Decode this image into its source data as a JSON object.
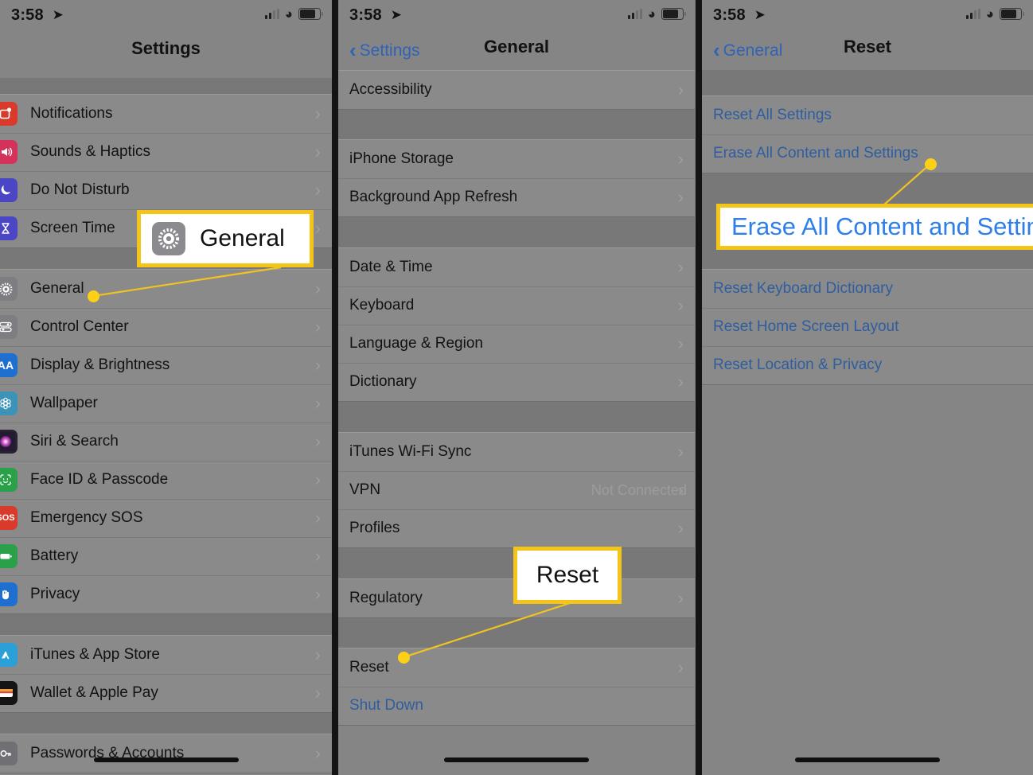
{
  "status_bar": {
    "time": "3:58",
    "location_arrow_icon": "location-arrow-icon",
    "cellular_icon": "cellular-signal-icon",
    "wifi_icon": "wifi-icon",
    "battery_icon": "battery-icon"
  },
  "colors": {
    "highlight_border": "#f4c517",
    "dot": "#fdd017",
    "link_blue": "#2f5d9e",
    "callout_blue": "#2f7fea",
    "overlay_gray": "#858585"
  },
  "panel_settings": {
    "title": "Settings",
    "groups": [
      {
        "rows": [
          {
            "label": "Notifications",
            "icon": "notifications-icon",
            "icon_color": "#d93a2b",
            "chevron": "›"
          },
          {
            "label": "Sounds & Haptics",
            "icon": "sounds-haptics-icon",
            "icon_color": "#d5325b",
            "chevron": "›"
          },
          {
            "label": "Do Not Disturb",
            "icon": "do-not-disturb-icon",
            "icon_color": "#4b46c4",
            "chevron": "›"
          },
          {
            "label": "Screen Time",
            "icon": "screen-time-icon",
            "icon_color": "#4b46c4",
            "chevron": "›"
          }
        ]
      },
      {
        "rows": [
          {
            "label": "General",
            "icon": "gear-icon",
            "icon_color": "#7e7e82",
            "chevron": "›"
          },
          {
            "label": "Control Center",
            "icon": "control-center-icon",
            "icon_color": "#7e7e82",
            "chevron": "›"
          },
          {
            "label": "Display & Brightness",
            "icon": "display-brightness-icon",
            "icon_color": "#1f6fd0",
            "chevron": "›"
          },
          {
            "label": "Wallpaper",
            "icon": "wallpaper-icon",
            "icon_color": "#3b93b8",
            "chevron": "›"
          },
          {
            "label": "Siri & Search",
            "icon": "siri-search-icon",
            "icon_color": "#2a2233",
            "chevron": "›"
          },
          {
            "label": "Face ID & Passcode",
            "icon": "face-id-icon",
            "icon_color": "#2aa04a",
            "chevron": "›"
          },
          {
            "label": "Emergency SOS",
            "icon": "emergency-sos-icon",
            "icon_color": "#d93a2b",
            "chevron": "›"
          },
          {
            "label": "Battery",
            "icon": "battery-settings-icon",
            "icon_color": "#2aa04a",
            "chevron": "›"
          },
          {
            "label": "Privacy",
            "icon": "privacy-hand-icon",
            "icon_color": "#1f6fd0",
            "chevron": "›"
          }
        ]
      },
      {
        "rows": [
          {
            "label": "iTunes & App Store",
            "icon": "app-store-icon",
            "icon_color": "#2a9fd8",
            "chevron": "›"
          },
          {
            "label": "Wallet & Apple Pay",
            "icon": "wallet-icon",
            "icon_color": "#111111",
            "chevron": "›"
          }
        ]
      },
      {
        "rows": [
          {
            "label": "Passwords & Accounts",
            "icon": "passwords-icon",
            "icon_color": "#6f6f74",
            "chevron": "›"
          }
        ]
      }
    ]
  },
  "panel_general": {
    "back_label": "Settings",
    "title": "General",
    "groups": [
      {
        "rows": [
          {
            "label": "Accessibility",
            "chevron": "›"
          }
        ]
      },
      {
        "rows": [
          {
            "label": "iPhone Storage",
            "chevron": "›"
          },
          {
            "label": "Background App Refresh",
            "chevron": "›"
          }
        ]
      },
      {
        "rows": [
          {
            "label": "Date & Time",
            "chevron": "›"
          },
          {
            "label": "Keyboard",
            "chevron": "›"
          },
          {
            "label": "Language & Region",
            "chevron": "›"
          },
          {
            "label": "Dictionary",
            "chevron": "›"
          }
        ]
      },
      {
        "rows": [
          {
            "label": "iTunes Wi-Fi Sync",
            "chevron": "›"
          },
          {
            "label": "VPN",
            "value": "Not Connected",
            "chevron": "›"
          },
          {
            "label": "Profiles",
            "chevron": "›"
          }
        ]
      },
      {
        "rows": [
          {
            "label": "Regulatory",
            "chevron": "›"
          }
        ]
      },
      {
        "rows": [
          {
            "label": "Reset",
            "chevron": "›"
          },
          {
            "label": "Shut Down",
            "link": true
          }
        ]
      }
    ]
  },
  "panel_reset": {
    "back_label": "General",
    "title": "Reset",
    "groups": [
      {
        "rows": [
          {
            "label": "Reset All Settings",
            "link": true
          },
          {
            "label": "Erase All Content and Settings",
            "link": true
          }
        ]
      },
      {
        "rows": [
          {
            "label": "Reset Keyboard Dictionary",
            "link": true
          },
          {
            "label": "Reset Home Screen Layout",
            "link": true
          },
          {
            "label": "Reset Location & Privacy",
            "link": true
          }
        ]
      }
    ]
  },
  "callouts": {
    "general": {
      "text": "General",
      "icon": "gear-icon"
    },
    "reset": {
      "text": "Reset"
    },
    "erase": {
      "text": "Erase All Content and Settings"
    }
  }
}
